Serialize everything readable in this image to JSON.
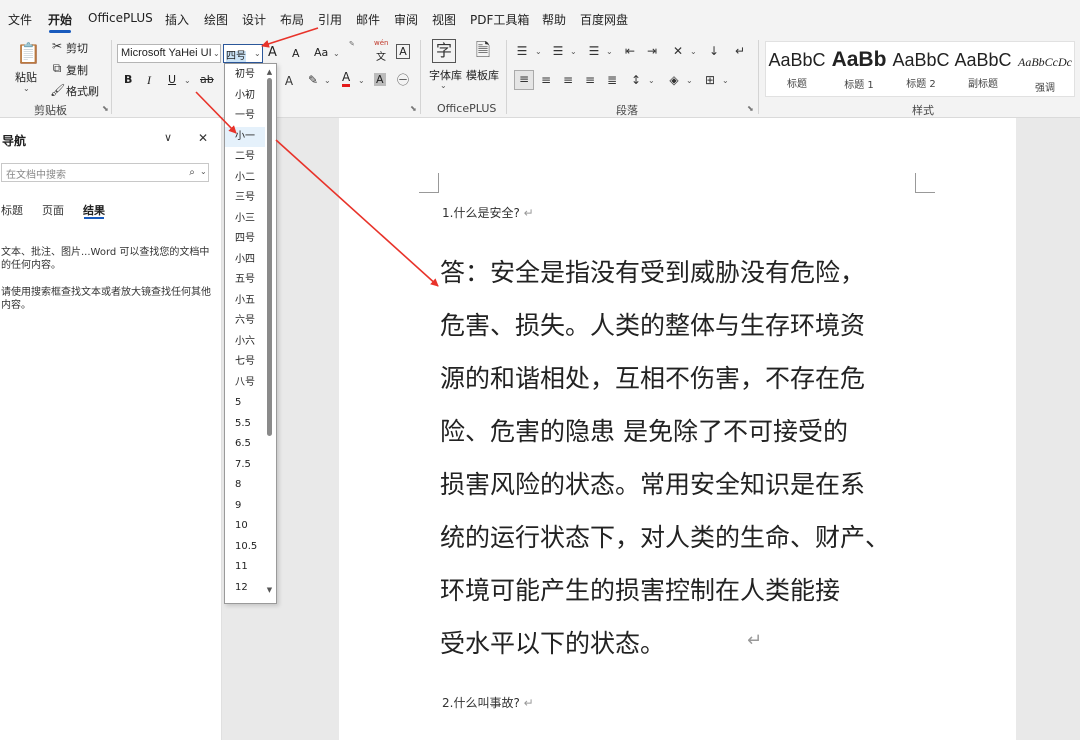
{
  "menu": {
    "tabs": [
      "文件",
      "开始",
      "OfficePLUS",
      "插入",
      "绘图",
      "设计",
      "布局",
      "引用",
      "邮件",
      "审阅",
      "视图",
      "PDF工具箱",
      "帮助",
      "百度网盘"
    ],
    "active": "开始"
  },
  "clipboard": {
    "paste": "粘贴",
    "cut": "剪切",
    "copy": "复制",
    "format_painter": "格式刷",
    "label": "剪贴板"
  },
  "font": {
    "name": "Microsoft YaHei UI",
    "size": "四号",
    "grow": "A",
    "shrink": "A",
    "case": "Aa",
    "phonetic_top": "wén",
    "phonetic_bottom": "文",
    "border_char": "A",
    "bold": "B",
    "italic": "I",
    "underline": "U",
    "strike": "ab",
    "highlight_letter": "A",
    "color_letter": "A"
  },
  "officeplus": {
    "font_lib": "字体库",
    "template_lib": "模板库",
    "label": "OfficePLUS"
  },
  "paragraph": {
    "label": "段落"
  },
  "styles": {
    "label": "样式",
    "items": [
      {
        "preview": "AaBbC",
        "name": "标题"
      },
      {
        "preview": "AaBb",
        "name": "标题 1"
      },
      {
        "preview": "AaBbC",
        "name": "标题 2"
      },
      {
        "preview": "AaBbC",
        "name": "副标题"
      },
      {
        "preview": "AaBbCcDc",
        "name": "强调"
      }
    ]
  },
  "nav": {
    "title": "导航",
    "search_placeholder": "在文档中搜索",
    "tabs": [
      "标题",
      "页面",
      "结果"
    ],
    "selected_tab": "结果",
    "help1": "文本、批注、图片...Word 可以查找您的文档中的任何内容。",
    "help2": "请使用搜索框查找文本或者放大镜查找任何其他内容。"
  },
  "font_size_dropdown": {
    "options": [
      "初号",
      "小初",
      "一号",
      "小一",
      "二号",
      "小二",
      "三号",
      "小三",
      "四号",
      "小四",
      "五号",
      "小五",
      "六号",
      "小六",
      "七号",
      "八号",
      "5",
      "5.5",
      "6.5",
      "7.5",
      "8",
      "9",
      "10",
      "10.5",
      "11",
      "12"
    ],
    "highlighted": "小一"
  },
  "document": {
    "q1": "1.什么是安全?",
    "answer_lines": [
      "答：安全是指没有受到威胁没有危险，",
      "危害、损失。人类的整体与生存环境资",
      "源的和谐相处，互相不伤害，不存在危",
      "险、危害的隐患  是免除了不可接受的",
      "损害风险的状态。常用安全知识是在系",
      "统的运行状态下，对人类的生命、财产、",
      "环境可能产生的损害控制在人类能接",
      "受水平以下的状态。"
    ],
    "q2": "2.什么叫事故?",
    "para_mark": "↵"
  },
  "colors": {
    "accent": "#185abd",
    "arrow": "#e8332a"
  }
}
